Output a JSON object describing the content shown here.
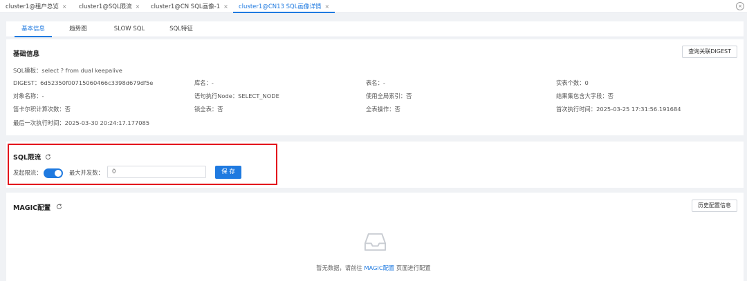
{
  "top_tabs": [
    {
      "label": "cluster1@租户总览"
    },
    {
      "label": "cluster1@SQL限流"
    },
    {
      "label": "cluster1@CN SQL画像-1"
    },
    {
      "label": "cluster1@CN13 SQL画像详情"
    }
  ],
  "tab_close_glyph": "×",
  "close_all_glyph": "×",
  "inner_tabs": [
    "基本信息",
    "趋势图",
    "SLOW SQL",
    "SQL特征"
  ],
  "basic": {
    "title": "基础信息",
    "query_digest_button": "查询关联DIGEST",
    "sql_template": "SQL模板：select ? from dual keepalive",
    "rows": [
      [
        "DIGEST：6d52350f00715060466c3398d679df5e",
        "库名：-",
        "表名：-",
        "实表个数：0"
      ],
      [
        "对象名称：-",
        "语句执行Node：SELECT_NODE",
        "使用全局索引：否",
        "结果集包含大字段：否"
      ],
      [
        "笛卡尔积计算次数：否",
        "锁全表：否",
        "全表操作：否",
        "首次执行时间：2025-03-25 17:31:56.191684"
      ]
    ],
    "last_exec": "最后一次执行时间：2025-03-30 20:24:17.177085"
  },
  "sql_limit": {
    "title": "SQL限流",
    "enable_label": "发起限流：",
    "enabled": true,
    "max_concurrency_label": "最大并发数：",
    "max_concurrency_value": "0",
    "save_button": "保 存"
  },
  "magic": {
    "title": "MAGIC配置",
    "history_button": "历史配置信息",
    "empty_text_before": "暂无数据，请前往 ",
    "empty_link": "MAGIC配置",
    "empty_text_after": " 页面进行配置"
  },
  "icons": {
    "refresh": "refresh-icon",
    "empty": "inbox-empty-icon",
    "close": "close-icon"
  },
  "colors": {
    "accent": "#1f7ae0",
    "highlight_border": "#e3141c",
    "background": "#f0f2f5"
  }
}
